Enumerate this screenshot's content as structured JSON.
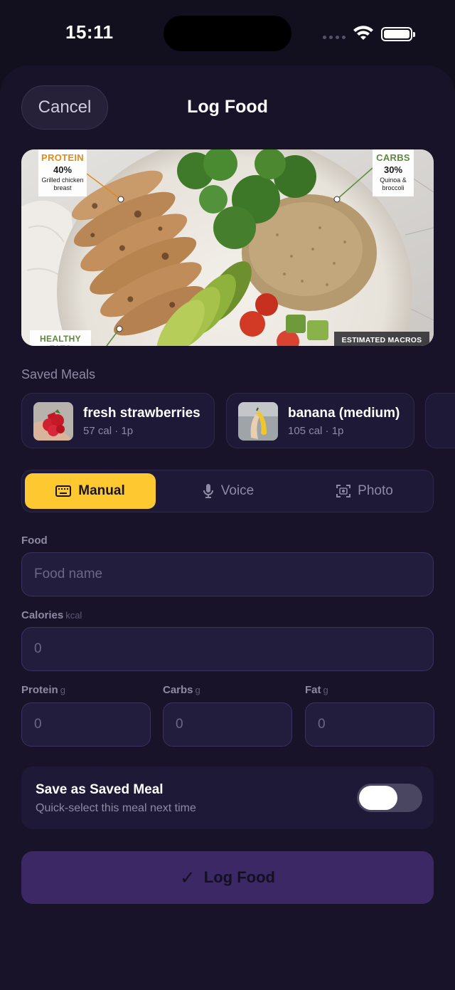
{
  "status_bar": {
    "time": "15:11"
  },
  "header": {
    "cancel_label": "Cancel",
    "title": "Log Food"
  },
  "hero": {
    "protein": {
      "label": "PROTEIN",
      "percent": "40%",
      "desc_line1": "Grilled chicken",
      "desc_line2": "breast"
    },
    "carbs": {
      "label": "CARBS",
      "percent": "30%",
      "desc_line1": "Quinoa &",
      "desc_line2": "broccoli"
    },
    "fats": {
      "label": "HEALTHY FATS"
    },
    "estimated": "ESTIMATED MACROS"
  },
  "saved_meals": {
    "section_title": "Saved Meals",
    "items": [
      {
        "name": "fresh strawberries",
        "meta": "57 cal · 1p"
      },
      {
        "name": "banana (medium)",
        "meta": "105 cal · 1p"
      }
    ]
  },
  "modes": {
    "active": "Manual",
    "items": [
      {
        "label": "Manual",
        "icon": "keyboard-icon"
      },
      {
        "label": "Voice",
        "icon": "microphone-icon"
      },
      {
        "label": "Photo",
        "icon": "camera-scan-icon"
      }
    ]
  },
  "form": {
    "food_label": "Food",
    "food_placeholder": "Food name",
    "calories_label": "Calories",
    "calories_unit": "kcal",
    "calories_placeholder": "0",
    "protein_label": "Protein",
    "protein_unit": "g",
    "protein_placeholder": "0",
    "carbs_label": "Carbs",
    "carbs_unit": "g",
    "carbs_placeholder": "0",
    "fat_label": "Fat",
    "fat_unit": "g",
    "fat_placeholder": "0"
  },
  "save_meal": {
    "title": "Save as Saved Meal",
    "subtitle": "Quick-select this meal next time",
    "enabled": false
  },
  "submit": {
    "label": "Log Food",
    "icon": "checkmark-icon"
  },
  "colors": {
    "background": "#120f1f",
    "sheet": "#181329",
    "accent": "#fdc830",
    "submit_button": "#3c2864"
  }
}
